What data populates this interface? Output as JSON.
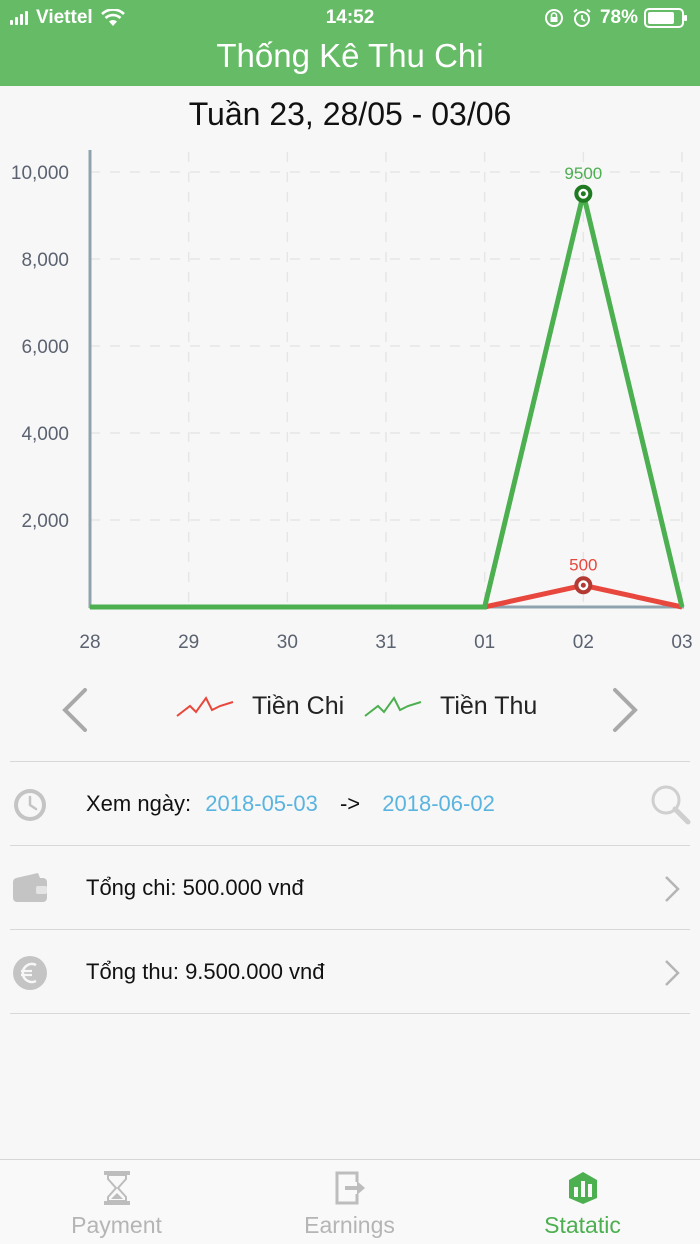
{
  "status": {
    "carrier": "Viettel",
    "time": "14:52",
    "battery": "78%"
  },
  "header": {
    "title": "Thống Kê Thu Chi"
  },
  "week_title": "Tuần 23, 28/05 - 03/06",
  "chart_data": {
    "type": "line",
    "x": [
      "28",
      "29",
      "30",
      "31",
      "01",
      "02",
      "03"
    ],
    "ylim": [
      0,
      10500
    ],
    "yticks": [
      2000,
      4000,
      6000,
      8000,
      10000
    ],
    "ytick_labels": [
      "2,000",
      "4,000",
      "6,000",
      "8,000",
      "10,000"
    ],
    "grid": true,
    "legend": "bottom",
    "series": [
      {
        "name": "Tiền Chi",
        "color": "#e8473d",
        "values": [
          0,
          0,
          0,
          0,
          0,
          500,
          0
        ],
        "label_index": 5,
        "label": "500"
      },
      {
        "name": "Tiền Thu",
        "color": "#4caf50",
        "values": [
          0,
          0,
          0,
          0,
          0,
          9500,
          0
        ],
        "label_index": 5,
        "label": "9500"
      }
    ]
  },
  "filter": {
    "label": "Xem ngày:",
    "from": "2018-05-03",
    "arrow": "->",
    "to": "2018-06-02"
  },
  "summary": {
    "expense": "Tổng chi: 500.000 vnđ",
    "income": "Tổng thu: 9.500.000 vnđ"
  },
  "tabs": [
    {
      "label": "Payment",
      "icon": "hourglass-icon"
    },
    {
      "label": "Earnings",
      "icon": "export-icon"
    },
    {
      "label": "Statatic",
      "icon": "stats-icon"
    }
  ],
  "colors": {
    "primary": "#66bb66",
    "link": "#5ab4e0",
    "active_tab": "#4caf50",
    "inactive": "#b5b5b5"
  }
}
